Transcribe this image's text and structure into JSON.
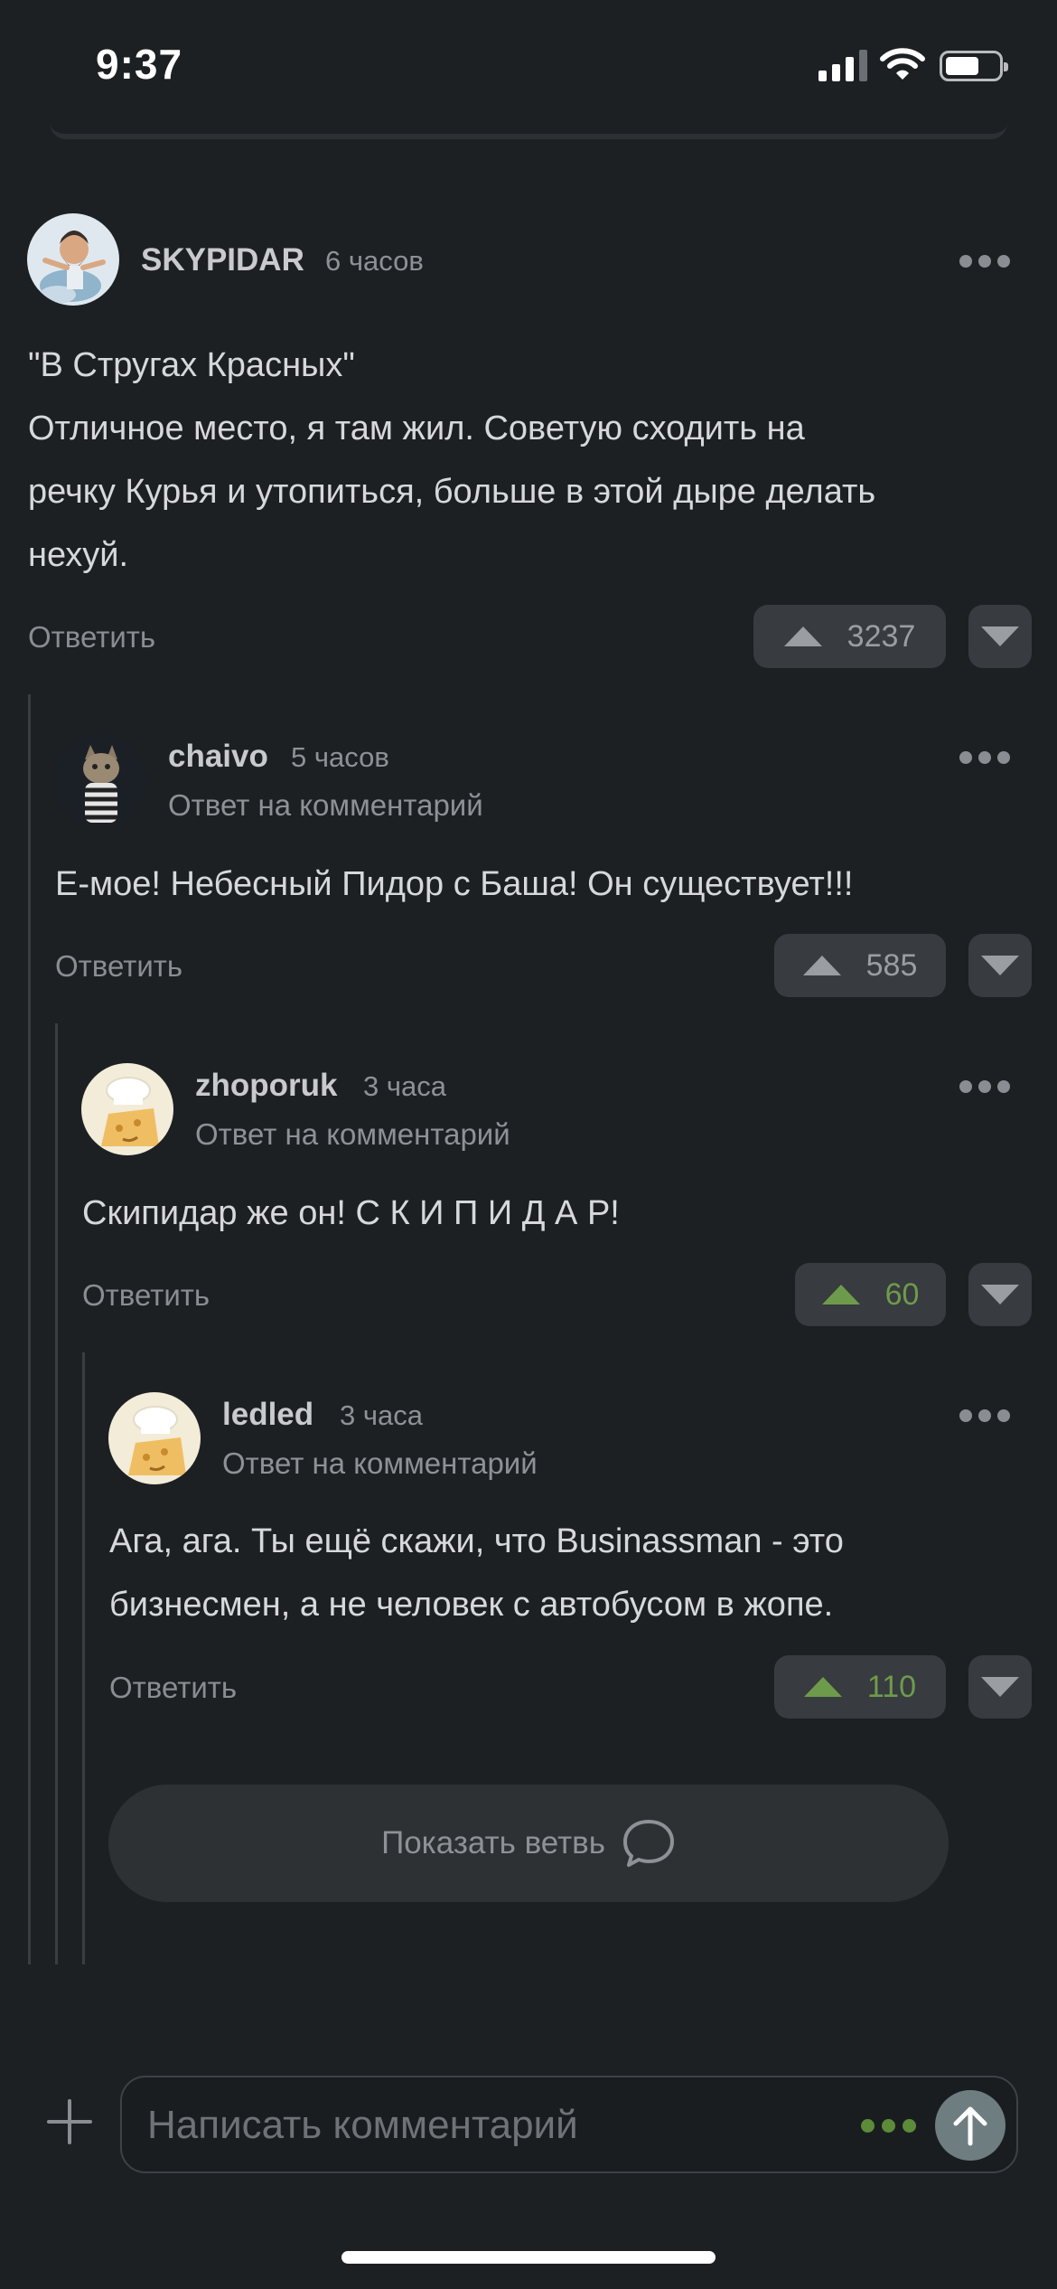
{
  "status_bar": {
    "time": "9:37"
  },
  "comments": [
    {
      "username": "SKYPIDAR",
      "time": "6 часов",
      "reply_to": "",
      "lines": [
        "\"В Стругах Красных\"",
        "Отличное место, я там жил. Советую сходить на",
        "речку Курья и утопиться, больше в этой дыре делать",
        "нехуй."
      ],
      "votes": "3237",
      "reply_label": "Ответить"
    },
    {
      "username": "chaivo",
      "time": "5 часов",
      "reply_to": "Ответ на комментарий",
      "lines": [
        "Е-мое! Небесный Пидор с Баша! Он существует!!!"
      ],
      "votes": "585",
      "reply_label": "Ответить"
    },
    {
      "username": "zhoporuk",
      "time": "3 часа",
      "reply_to": "Ответ на комментарий",
      "lines": [
        "Скипидар же он! С К И П И Д А Р!"
      ],
      "votes": "60",
      "reply_label": "Ответить"
    },
    {
      "username": "ledled",
      "time": "3 часа",
      "reply_to": "Ответ на комментарий",
      "lines": [
        "Ага, ага. Ты ещё скажи, что Businassman - это",
        "бизнесмен, а не человек с автобусом в жопе."
      ],
      "votes": "110",
      "reply_label": "Ответить"
    }
  ],
  "show_branch": {
    "label": "Показать ветвь"
  },
  "composer": {
    "placeholder": "Написать комментарий"
  },
  "colors": {
    "background": "#1d2023",
    "upvoted": "#6e9b4b",
    "accent_green": "#5c8b3a"
  },
  "icons": [
    "plus-icon",
    "send-arrow-icon",
    "speech-bubble-icon",
    "more-dots-icon",
    "upvote-arrow-icon",
    "downvote-arrow-icon"
  ]
}
